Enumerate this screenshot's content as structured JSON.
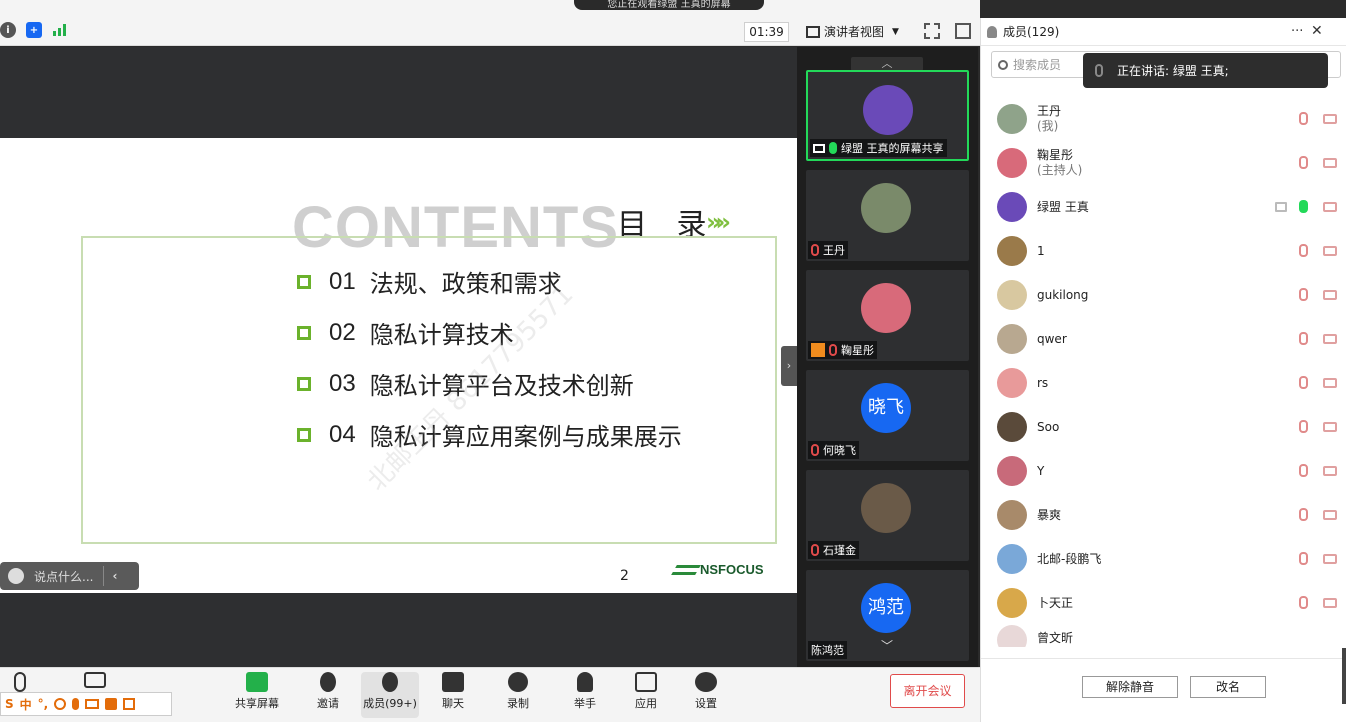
{
  "window": {
    "banner": "您正在观看绿盟 王真的屏幕",
    "timer": "01:39",
    "view_mode": "演讲者视图"
  },
  "slide": {
    "watermark_title": "CONTENTS",
    "title": "目 录",
    "chevrons": "»»",
    "items": [
      {
        "num": "01",
        "label": "法规、政策和需求"
      },
      {
        "num": "02",
        "label": "隐私计算技术"
      },
      {
        "num": "03",
        "label": "隐私计算平台及技术创新"
      },
      {
        "num": "04",
        "label": "隐私计算应用案例与成果展示"
      }
    ],
    "page_number": "2",
    "logo_text": "NSFOCUS",
    "watermark_text": "北邮王丹 8617795571"
  },
  "chat": {
    "placeholder": "说点什么..."
  },
  "gallery": {
    "tiles": [
      {
        "name": "绿盟 王真的屏幕共享",
        "active": true,
        "avatar": "avatar-purple",
        "avatar_color": "#6a4ab8",
        "mic": "on"
      },
      {
        "name": "王丹",
        "active": false,
        "avatar": "avatar-panda",
        "avatar_color": "#7a8a6a",
        "mic": "off"
      },
      {
        "name": "鞠星彤",
        "active": false,
        "avatar": "avatar-cartoon",
        "avatar_color": "#d86a7a",
        "mic": "off"
      },
      {
        "name": "何晓飞",
        "active": false,
        "avatar_text": "晓飞",
        "mic": "off"
      },
      {
        "name": "石瑾金",
        "active": false,
        "avatar": "avatar-dog",
        "avatar_color": "#6a5a48",
        "mic": "off"
      },
      {
        "name": "陈鸿范",
        "active": false,
        "avatar_text": "鸿范",
        "mic": "none"
      }
    ]
  },
  "toolbar": {
    "share": "共享屏幕",
    "invite": "邀请",
    "members": "成员(99+)",
    "chat": "聊天",
    "record": "录制",
    "raise_hand": "举手",
    "apps": "应用",
    "settings": "设置",
    "leave": "离开会议"
  },
  "ime": {
    "lang": "中",
    "punct": "°,"
  },
  "panel": {
    "title": "成员(129)",
    "more": "···",
    "close": "✕",
    "search_placeholder": "搜索成员",
    "speaking": "正在讲话: 绿盟 王真;",
    "members": [
      {
        "name": "王丹",
        "role": "(我)",
        "color": "#8fa38a",
        "mic": "off",
        "share": false
      },
      {
        "name": "鞠星彤",
        "role": "(主持人)",
        "color": "#d86a7a",
        "mic": "off",
        "share": false
      },
      {
        "name": "绿盟 王真",
        "role": "",
        "color": "#6a4ab8",
        "mic": "on",
        "share": true
      },
      {
        "name": "1",
        "role": "",
        "color": "#9a7a4a",
        "mic": "off",
        "share": false
      },
      {
        "name": "gukilong",
        "role": "",
        "color": "#d8c8a0",
        "mic": "off",
        "share": false
      },
      {
        "name": "qwer",
        "role": "",
        "color": "#b8a890",
        "mic": "off",
        "share": false
      },
      {
        "name": "rs",
        "role": "",
        "color": "#e89a9a",
        "mic": "off",
        "share": false
      },
      {
        "name": "Soo",
        "role": "",
        "color": "#5a4a3a",
        "mic": "off",
        "share": false
      },
      {
        "name": "Y",
        "role": "",
        "color": "#c86a7a",
        "mic": "off",
        "share": false
      },
      {
        "name": "暴爽",
        "role": "",
        "color": "#a88a6a",
        "mic": "off",
        "share": false
      },
      {
        "name": "北邮-段鹏飞",
        "role": "",
        "color": "#7aa8d8",
        "mic": "off",
        "share": false
      },
      {
        "name": "卜天正",
        "role": "",
        "color": "#d8a84a",
        "mic": "off",
        "share": false
      },
      {
        "name": "曾文昕",
        "role": "",
        "color": "#e8d8d8",
        "mic": "off",
        "share": false
      }
    ],
    "unmute_all": "解除静音",
    "rename": "改名"
  }
}
